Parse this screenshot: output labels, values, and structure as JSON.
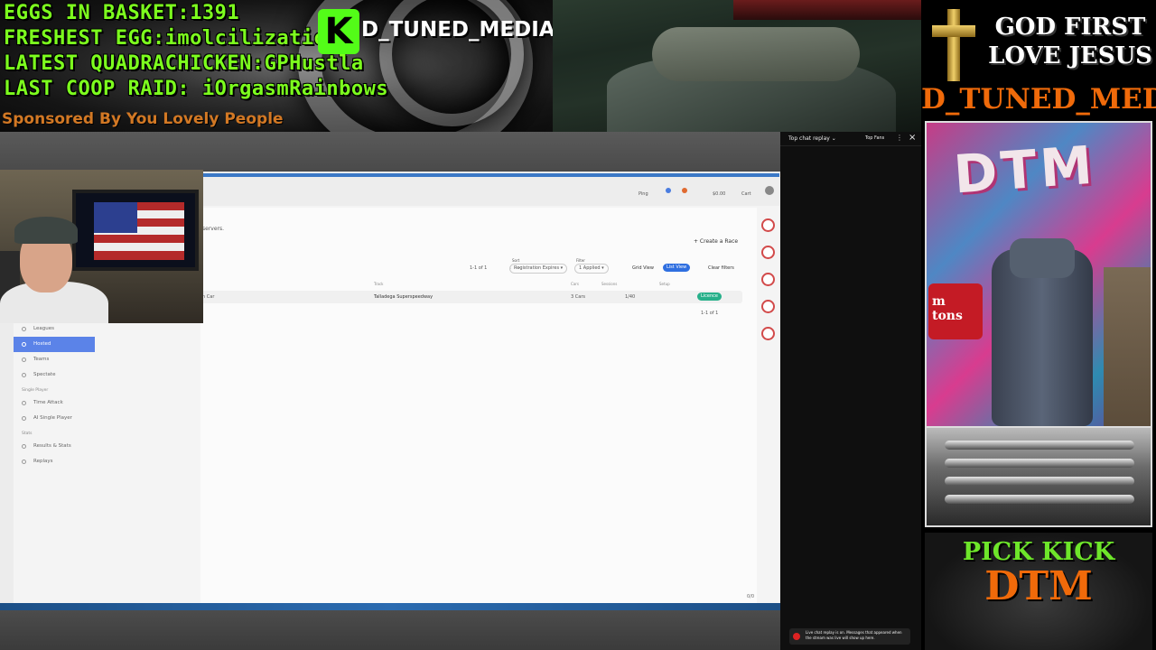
{
  "overlay": {
    "stats": [
      {
        "label": "EGGS IN BASKET:",
        "value": "1391"
      },
      {
        "label": "FRESHEST EGG:",
        "value": "imolcilizationn"
      },
      {
        "label": "LATEST QUADRACHICKEN:",
        "value": "GPHustla"
      },
      {
        "label": "LAST COOP RAID:",
        "value": "iOrgasmRainbows"
      }
    ],
    "sponsor": "Sponsored By You Lovely People",
    "kick_logo": "K",
    "channel_top": "D_TUNED_MEDIA",
    "faith_line1": "GOD FIRST",
    "faith_line2": "LOVE JESUS",
    "channel_right": "D_TUNED_MEDIA",
    "pick_kick": "PICK KICK",
    "dtm": "DTM",
    "room_graffiti": "DTM",
    "room_sign": "m\ntons"
  },
  "app": {
    "subtitle_fragment": "servers.",
    "create_race": "+ Create a Race",
    "page_count": "1-1 of 1",
    "sort_label": "Sort",
    "sort_value": "Registration Expires",
    "filter_label": "Filter",
    "filter_value": "1 Applied",
    "grid_view": "Grid View",
    "list_view": "List View",
    "clear_filters": "Clear filters",
    "table_headers": [
      "Track",
      "Cars",
      "Sessions",
      "Setup"
    ],
    "row": {
      "name_fragment": "n Car",
      "track": "Talladega Superspeedway",
      "cars": "3 Cars",
      "entries": "1/40",
      "action": "Licence"
    },
    "page_footer": "1-1 of 1",
    "top_actions": [
      "Ping",
      "$0.00",
      "Cart"
    ],
    "bottom_count": "0/0",
    "sidebar": [
      {
        "type": "item",
        "label": "Leagues",
        "active": false
      },
      {
        "type": "item",
        "label": "Hosted",
        "active": true
      },
      {
        "type": "item",
        "label": "Teams",
        "active": false
      },
      {
        "type": "item",
        "label": "Spectate",
        "active": false
      },
      {
        "type": "head",
        "label": "Single Player"
      },
      {
        "type": "item",
        "label": "Time Attack",
        "active": false
      },
      {
        "type": "item",
        "label": "AI Single Player",
        "active": false
      },
      {
        "type": "head",
        "label": "Stats"
      },
      {
        "type": "item",
        "label": "Results & Stats",
        "active": false
      },
      {
        "type": "item",
        "label": "Replays",
        "active": false
      }
    ]
  },
  "chat": {
    "title": "Top chat replay",
    "filter": "Top Fans",
    "notice": "Live chat replay is on. Messages that appeared when the stream was live will show up here."
  }
}
